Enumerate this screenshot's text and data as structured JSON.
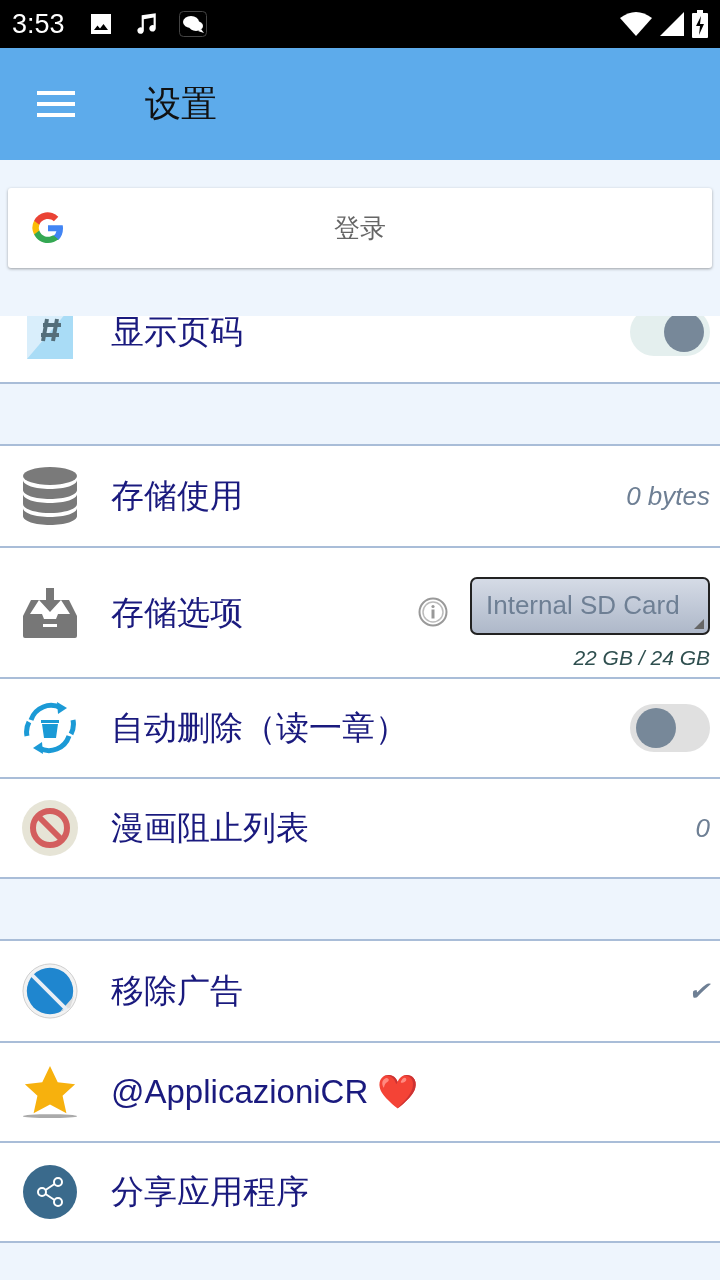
{
  "status_bar": {
    "time": "3:53"
  },
  "app_bar": {
    "title": "设置"
  },
  "sign_in": {
    "label": "登录"
  },
  "sections": [
    {
      "cut_top": true,
      "rows": [
        {
          "kind": "toggle",
          "label": "显示页码",
          "on": true
        }
      ]
    },
    {
      "rows": [
        {
          "kind": "value",
          "label": "存储使用",
          "value": "0 bytes"
        },
        {
          "kind": "dropdown",
          "label": "存储选项",
          "value": "Internal SD Card",
          "note": "22 GB / 24 GB"
        },
        {
          "kind": "toggle",
          "label": "自动删除（读一章）",
          "on": false
        },
        {
          "kind": "value",
          "label": "漫画阻止列表",
          "value": "0"
        }
      ]
    },
    {
      "rows": [
        {
          "kind": "value",
          "label": "移除广告",
          "value": "✔"
        },
        {
          "kind": "plain",
          "label": "@ApplicazioniCR ❤️"
        },
        {
          "kind": "plain",
          "label": "分享应用程序"
        }
      ]
    }
  ]
}
